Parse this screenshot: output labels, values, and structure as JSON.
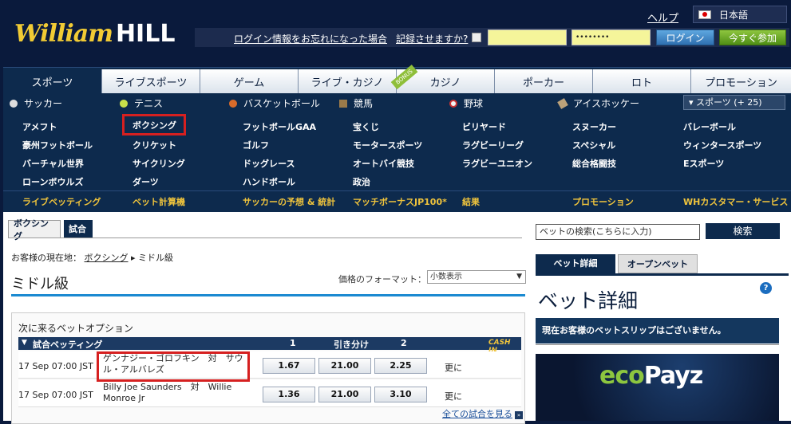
{
  "header": {
    "logo_william": "William",
    "logo_hill": "HILL",
    "help": "ヘルプ",
    "language": "日本語",
    "forgot_login": "ログイン情報をお忘れになった場合",
    "remember_me": "記録させますか?",
    "password_mask": "••••••••",
    "login_button": "ログイン",
    "join_button": "今すぐ参加"
  },
  "main_tabs": [
    "スポーツ",
    "ライブスポーツ",
    "ゲーム",
    "ライブ・カジノ",
    "カジノ",
    "ポーカー",
    "ロト",
    "プロモーション"
  ],
  "bonus_tag": "BONUS",
  "featured_sports": [
    "サッカー",
    "テニス",
    "バスケットボール",
    "競馬",
    "野球",
    "アイスホッケー"
  ],
  "more_sports": "▾ スポーツ (+ 25)",
  "sports_grid": [
    [
      "アメフト",
      "ボクシング",
      "フットボールGAA",
      "宝くじ",
      "ビリヤード",
      "スヌーカー",
      "バレーボール"
    ],
    [
      "豪州フットボール",
      "クリケット",
      "ゴルフ",
      "モータースポーツ",
      "ラグビーリーグ",
      "スペシャル",
      "ウィンタースポーツ"
    ],
    [
      "バーチャル世界",
      "サイクリング",
      "ドッグレース",
      "オートバイ競技",
      "ラグビーユニオン",
      "総合格闘技",
      "Eスポーツ"
    ],
    [
      "ローンボウルズ",
      "ダーツ",
      "ハンドボール",
      "政治"
    ]
  ],
  "bottom_nav": [
    "ライブベッティング",
    "ベット計算機",
    "サッカーの予想 & 統計",
    "マッチボーナスJP100*",
    "結果",
    "プロモーション",
    "WHカスタマー・サービス"
  ],
  "content": {
    "tab_boxing": "ボクシング",
    "tab_match": "試合",
    "breadcrumb_label": "お客様の現在地：",
    "breadcrumb_link": "ボクシング",
    "breadcrumb_current": "ミドル級",
    "page_title": "ミドル級",
    "price_format_label": "価格のフォーマット：",
    "price_format_value": "小数表示",
    "upcoming_header": "次に来るベットオプション",
    "group_title": "試合ベッティング",
    "col1": "1",
    "col_draw": "引き分け",
    "col2": "2",
    "cash_in": "CASH IN",
    "rows": [
      {
        "date": "17 Sep   07:00 JST",
        "match": "ゲンナジー・ゴロフキン　対　サウル・アルバレズ",
        "o1": "1.67",
        "ox": "21.00",
        "o2": "2.25",
        "more": "更に"
      },
      {
        "date": "17 Sep   07:00 JST",
        "match": "Billy Joe Saunders　対　Willie Monroe Jr",
        "o1": "1.36",
        "ox": "21.00",
        "o2": "3.10",
        "more": "更に"
      }
    ],
    "all_matches_link": "全ての試合を見る"
  },
  "sidebar": {
    "search_placeholder": "ベットの検索(こちらに入力)",
    "search_button": "検索",
    "tab_bet_detail": "ベット詳細",
    "tab_open_bets": "オープンベット",
    "betslip_title": "ベット詳細",
    "betslip_empty": "現在お客様のベットスリップはございません。",
    "ad_eco": "eco",
    "ad_payz": "Payz"
  },
  "colors": {
    "navy": "#0d2a4d",
    "gold": "#f0c43c",
    "highlight_red": "#d62020",
    "accent_blue": "#1b8ad1"
  }
}
